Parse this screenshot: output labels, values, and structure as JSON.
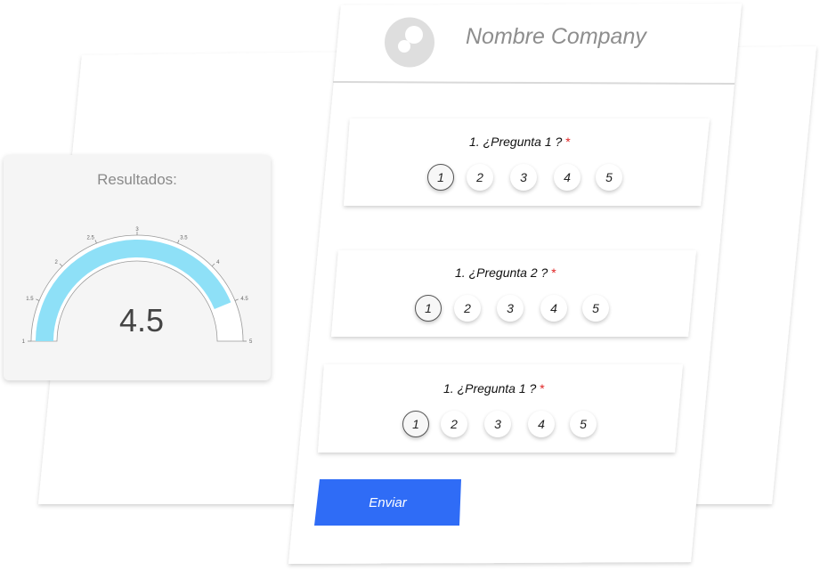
{
  "company": {
    "name": "Nombre Company",
    "logo": "company-logo-icon"
  },
  "survey": {
    "questions": [
      {
        "label": "1. ¿Pregunta 1 ?",
        "required_mark": "*",
        "options": [
          "1",
          "2",
          "3",
          "4",
          "5"
        ],
        "selected": "1"
      },
      {
        "label": "1. ¿Pregunta 2 ?",
        "required_mark": "*",
        "options": [
          "1",
          "2",
          "3",
          "4",
          "5"
        ],
        "selected": "1"
      },
      {
        "label": "1. ¿Pregunta 1 ?",
        "required_mark": "*",
        "options": [
          "1",
          "2",
          "3",
          "4",
          "5"
        ],
        "selected": "1"
      }
    ],
    "submit_label": "Enviar"
  },
  "results": {
    "title": "Resultados:",
    "value_text": "4.5"
  },
  "chart_data": {
    "type": "gauge",
    "min": 1,
    "max": 5,
    "value": 4.5,
    "tick_labels": [
      "1",
      "1.5",
      "2",
      "2.5",
      "3",
      "3.5",
      "4",
      "4.5",
      "5"
    ],
    "fill_color": "#8ee0f7",
    "track_color": "#ffffff"
  },
  "colors": {
    "accent": "#2f6cf6",
    "required": "#e02424",
    "text_muted": "#8e8e8e"
  }
}
